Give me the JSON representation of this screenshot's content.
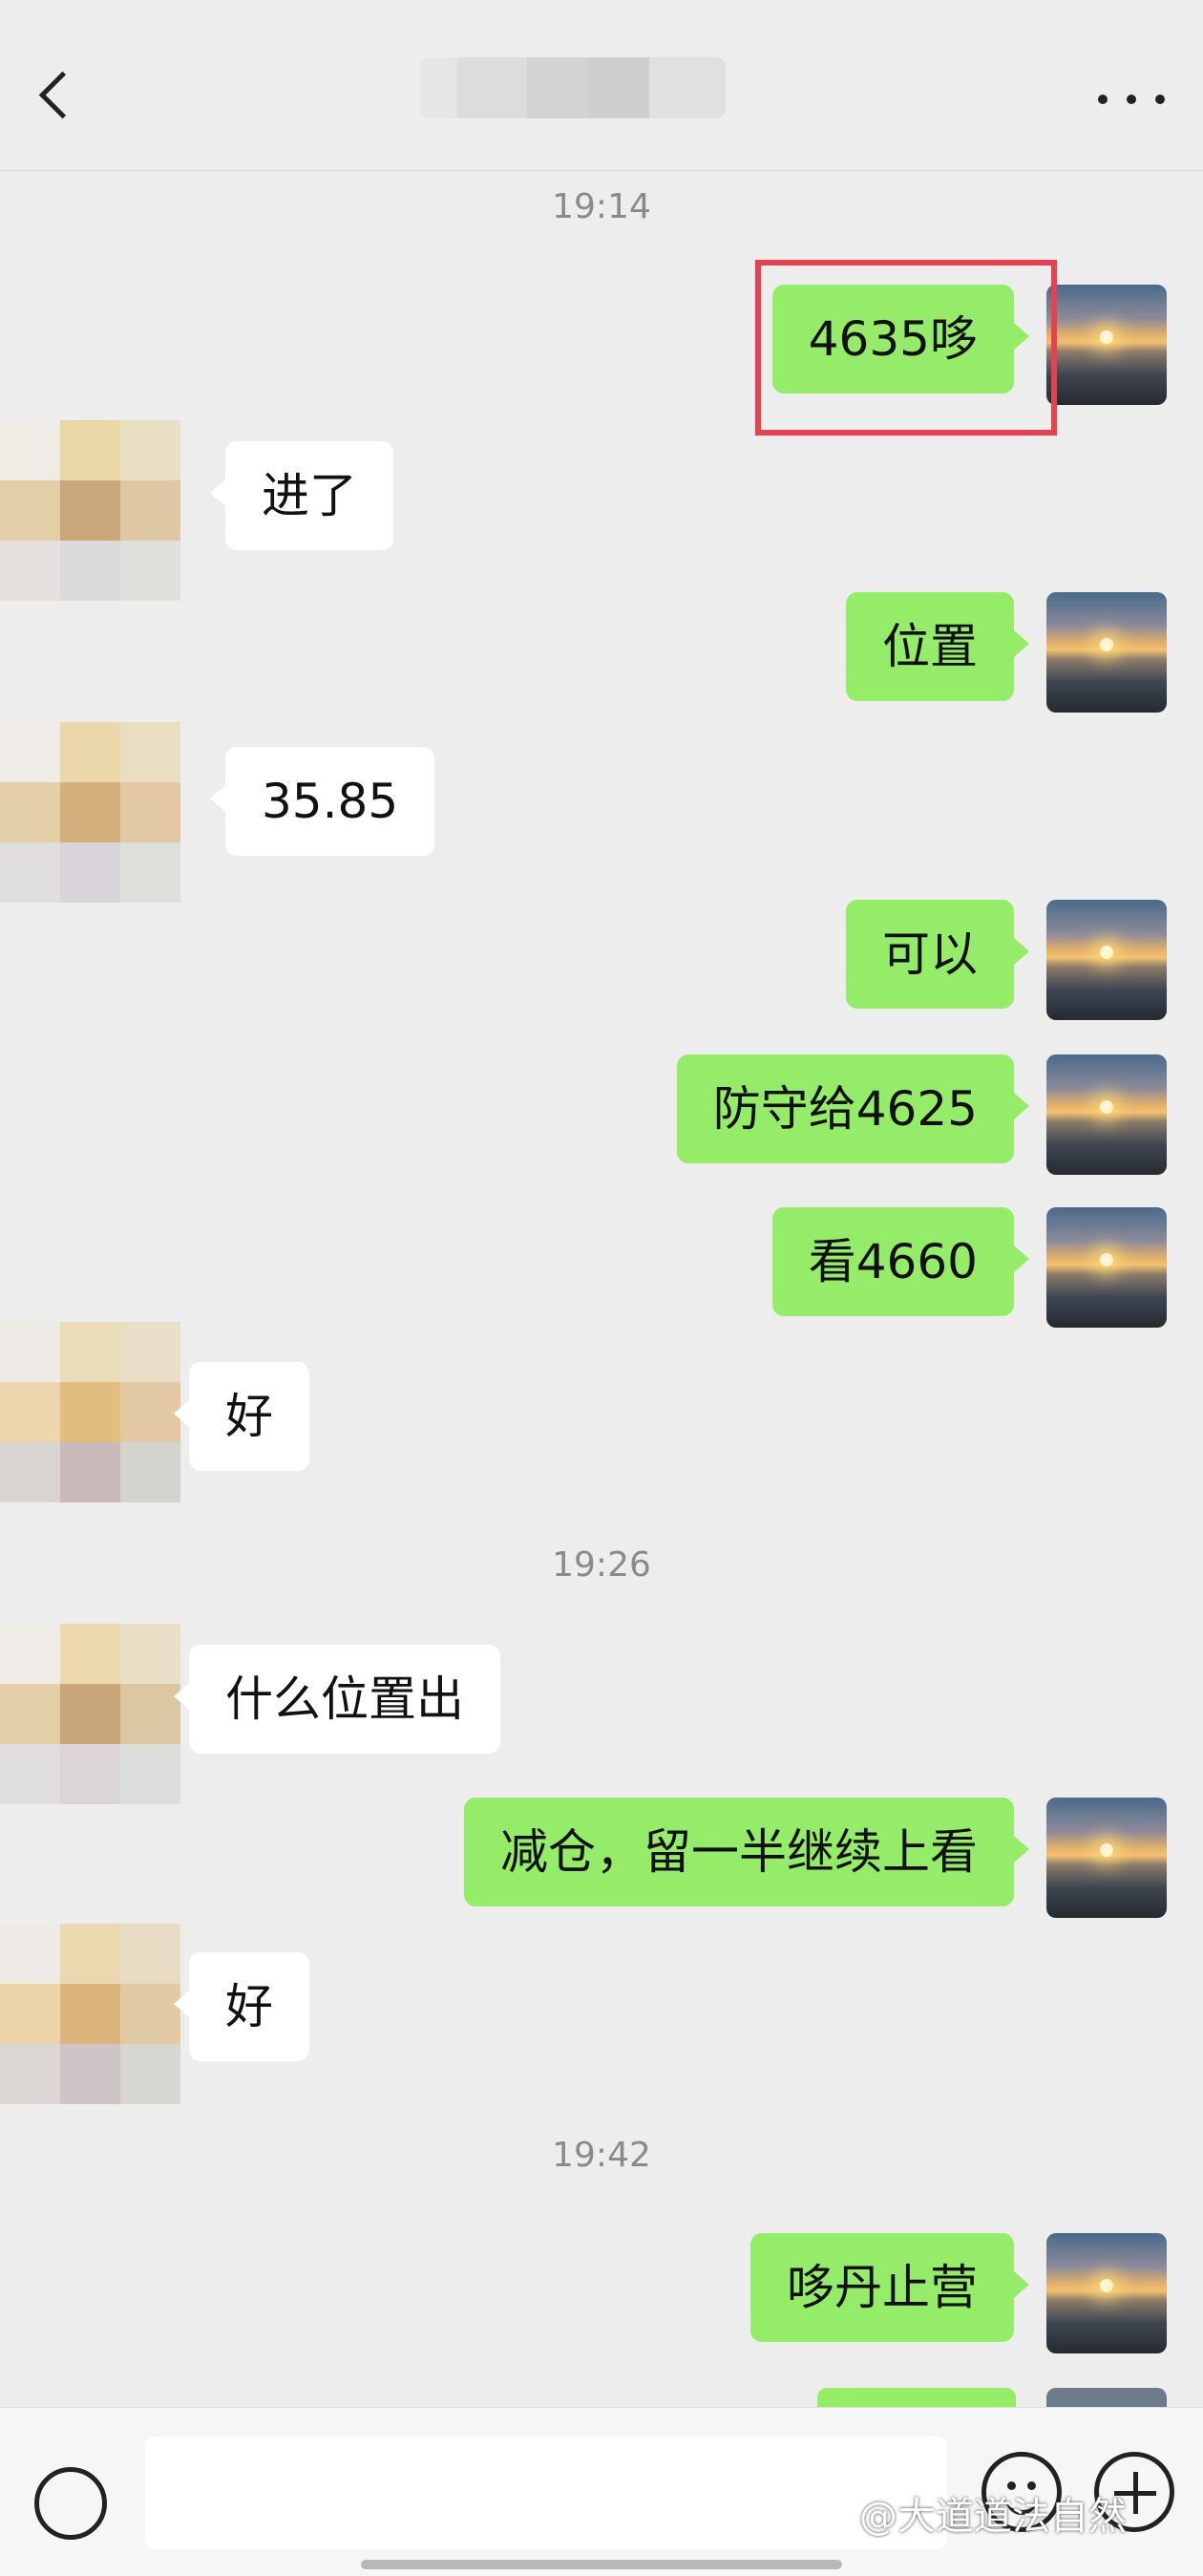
{
  "header": {
    "title": ""
  },
  "timestamps": [
    "19:14",
    "19:26",
    "19:42"
  ],
  "messages": [
    {
      "text": "4635哆",
      "side": "me"
    },
    {
      "text": "进了",
      "side": "them"
    },
    {
      "text": "位置",
      "side": "me"
    },
    {
      "text": "35.85",
      "side": "them"
    },
    {
      "text": "可以",
      "side": "me"
    },
    {
      "text": "防守给4625",
      "side": "me"
    },
    {
      "text": "看4660",
      "side": "me"
    },
    {
      "text": "好",
      "side": "them"
    },
    {
      "text": "什么位置出",
      "side": "them"
    },
    {
      "text": "减仓，留一半继续上看",
      "side": "me"
    },
    {
      "text": "好",
      "side": "them"
    },
    {
      "text": "哆丹止营",
      "side": "me"
    }
  ],
  "watermark": "@大道道法自然",
  "colors": {
    "my_bubble": "#95ec69",
    "their_bubble": "#ffffff",
    "background": "#ededed",
    "highlight": "#e8404f"
  }
}
